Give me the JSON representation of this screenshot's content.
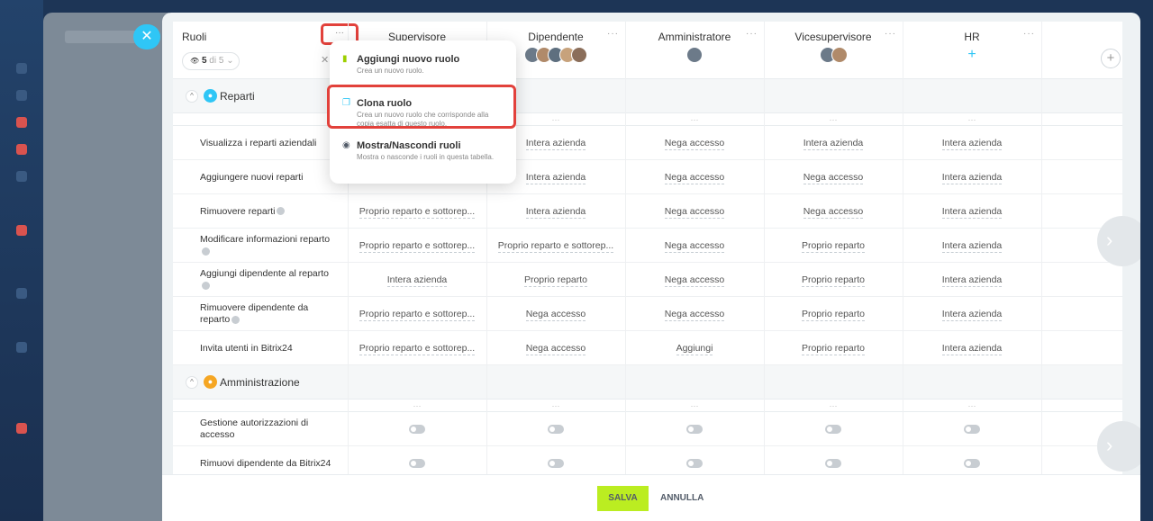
{
  "header": {
    "roles_title": "Ruoli",
    "filter_count": "5",
    "filter_total": "di 5",
    "dots": "···",
    "roles": [
      {
        "name": "Supervisore",
        "avatars": 0
      },
      {
        "name": "Dipendente",
        "avatars": 5
      },
      {
        "name": "Amministratore",
        "avatars": 1
      },
      {
        "name": "Vicesupervisore",
        "avatars": 2
      },
      {
        "name": "HR",
        "avatars": 0
      }
    ]
  },
  "sections": [
    {
      "title": "Reparti",
      "icon": "group-icon",
      "color": "#2fc6f6"
    },
    {
      "title": "Amministrazione",
      "icon": "user-icon",
      "color": "#f5a623"
    }
  ],
  "rows_reparti": [
    {
      "label": "Visualizza i reparti aziendali",
      "help": false,
      "values": [
        "",
        "Intera azienda",
        "Nega accesso",
        "Intera azienda",
        "Intera azienda"
      ]
    },
    {
      "label": "Aggiungere nuovi reparti",
      "help": false,
      "values": [
        "",
        "Intera azienda",
        "Nega accesso",
        "Nega accesso",
        "Intera azienda"
      ]
    },
    {
      "label": "Rimuovere reparti",
      "help": true,
      "values": [
        "Proprio reparto e sottorep...",
        "Intera azienda",
        "Nega accesso",
        "Nega accesso",
        "Intera azienda"
      ]
    },
    {
      "label": "Modificare informazioni reparto",
      "help": true,
      "values": [
        "Proprio reparto e sottorep...",
        "Proprio reparto e sottorep...",
        "Nega accesso",
        "Proprio reparto",
        "Intera azienda"
      ]
    },
    {
      "label": "Aggiungi dipendente al reparto",
      "help": true,
      "values": [
        "Intera azienda",
        "Proprio reparto",
        "Nega accesso",
        "Proprio reparto",
        "Intera azienda"
      ]
    },
    {
      "label": "Rimuovere dipendente da reparto",
      "help": true,
      "values": [
        "Proprio reparto e sottorep...",
        "Nega accesso",
        "Nega accesso",
        "Proprio reparto",
        "Intera azienda"
      ]
    },
    {
      "label": "Invita utenti in Bitrix24",
      "help": false,
      "values": [
        "Proprio reparto e sottorep...",
        "Nega accesso",
        "Aggiungi",
        "Proprio reparto",
        "Intera azienda"
      ]
    }
  ],
  "rows_amministrazione": [
    {
      "label": "Gestione autorizzazioni di accesso",
      "toggles": [
        false,
        false,
        false,
        false,
        false
      ]
    },
    {
      "label": "Rimuovi dipendente da Bitrix24",
      "toggles": [
        false,
        false,
        false,
        false,
        false
      ]
    }
  ],
  "menu": [
    {
      "title": "Aggiungi nuovo ruolo",
      "desc": "Crea un nuovo ruolo.",
      "icon": "add-role-icon",
      "highlighted": false
    },
    {
      "title": "Clona ruolo",
      "desc": "Crea un nuovo ruolo che corrisponde alla copia esatta di questo ruolo.",
      "icon": "copy-icon",
      "highlighted": true
    },
    {
      "title": "Mostra/Nascondi ruoli",
      "desc": "Mostra o nasconde i ruoli in questa tabella.",
      "icon": "eye-icon",
      "highlighted": false
    }
  ],
  "footer": {
    "save": "SALVA",
    "cancel": "ANNULLA"
  },
  "colors": {
    "accent": "#2fc6f6",
    "save": "#bbed21",
    "highlight": "#e2413b"
  }
}
